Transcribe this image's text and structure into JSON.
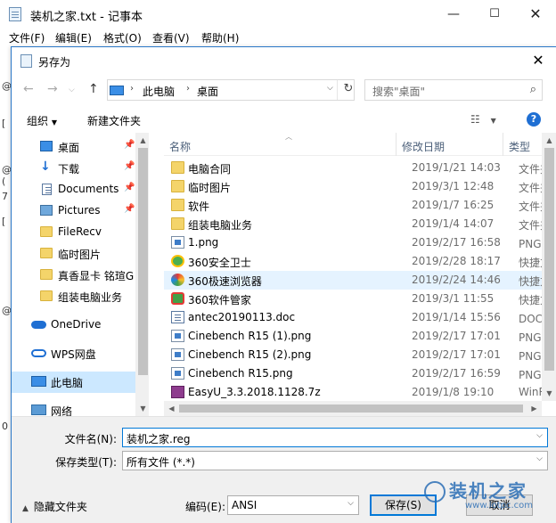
{
  "notepad": {
    "title": "装机之家.txt - 记事本",
    "menu": [
      "文件(F)",
      "编辑(E)",
      "格式(O)",
      "查看(V)",
      "帮助(H)"
    ],
    "edge_chars": [
      "@",
      "[",
      "@",
      "(",
      "7",
      "[",
      "@",
      "0"
    ]
  },
  "dialog": {
    "title": "另存为",
    "address": {
      "root": "此电脑",
      "current": "桌面"
    },
    "search_placeholder": "搜索\"桌面\"",
    "toolbar": {
      "organize": "组织",
      "new_folder": "新建文件夹"
    }
  },
  "nav": {
    "items": [
      {
        "label": "桌面",
        "icon": "desktop-icon",
        "pinned": true
      },
      {
        "label": "下载",
        "icon": "download-icon",
        "pinned": true
      },
      {
        "label": "Documents",
        "icon": "documents-icon",
        "pinned": true
      },
      {
        "label": "Pictures",
        "icon": "pictures-icon",
        "pinned": true
      },
      {
        "label": "FileRecv",
        "icon": "folder-icon",
        "pinned": false
      },
      {
        "label": "临时图片",
        "icon": "folder-icon",
        "pinned": false
      },
      {
        "label": "真香显卡 铭瑄G",
        "icon": "folder-icon",
        "pinned": false
      },
      {
        "label": "组装电脑业务",
        "icon": "folder-icon",
        "pinned": false
      },
      {
        "label": "OneDrive",
        "icon": "onedrive-icon",
        "pinned": false
      },
      {
        "label": "WPS网盘",
        "icon": "cloud-icon",
        "pinned": false
      },
      {
        "label": "此电脑",
        "icon": "pc-icon",
        "pinned": false,
        "selected": true
      },
      {
        "label": "网络",
        "icon": "network-icon",
        "pinned": false
      }
    ]
  },
  "files": {
    "columns": {
      "name": "名称",
      "date": "修改日期",
      "type": "类型"
    },
    "rows": [
      {
        "name": "电脑合同",
        "date": "2019/1/21 14:03",
        "type": "文件夹",
        "icon": "folder-icon"
      },
      {
        "name": "临时图片",
        "date": "2019/3/1 12:48",
        "type": "文件夹",
        "icon": "folder-icon"
      },
      {
        "name": "软件",
        "date": "2019/1/7 16:25",
        "type": "文件夹",
        "icon": "folder-icon"
      },
      {
        "name": "组装电脑业务",
        "date": "2019/1/4 14:07",
        "type": "文件夹",
        "icon": "folder-icon"
      },
      {
        "name": "1.png",
        "date": "2019/2/17 16:58",
        "type": "PNG 文",
        "icon": "png-icon"
      },
      {
        "name": "360安全卫士",
        "date": "2019/2/28 18:17",
        "type": "快捷方",
        "icon": "360-safe-icon"
      },
      {
        "name": "360极速浏览器",
        "date": "2019/2/24 14:46",
        "type": "快捷方",
        "icon": "360-browser-icon",
        "hover": true
      },
      {
        "name": "360软件管家",
        "date": "2019/3/1 11:55",
        "type": "快捷方",
        "icon": "360-manager-icon"
      },
      {
        "name": "antec20190113.doc",
        "date": "2019/1/14 15:56",
        "type": "DOC 文",
        "icon": "doc-icon"
      },
      {
        "name": "Cinebench R15 (1).png",
        "date": "2019/2/17 17:01",
        "type": "PNG 文",
        "icon": "png-icon"
      },
      {
        "name": "Cinebench R15 (2).png",
        "date": "2019/2/17 17:01",
        "type": "PNG 文",
        "icon": "png-icon"
      },
      {
        "name": "Cinebench R15.png",
        "date": "2019/2/17 16:59",
        "type": "PNG 文",
        "icon": "png-icon"
      },
      {
        "name": "EasyU_3.3.2018.1128.7z",
        "date": "2019/1/8 19:10",
        "type": "WinRA",
        "icon": "archive-icon"
      }
    ]
  },
  "bottom": {
    "filename_label": "文件名(N):",
    "filename_value": "装机之家.reg",
    "filetype_label": "保存类型(T):",
    "filetype_value": "所有文件 (*.*)",
    "hide_folders": "隐藏文件夹",
    "encoding_label": "编码(E):",
    "encoding_value": "ANSI",
    "save": "保存(S)",
    "cancel": "取消"
  },
  "watermark": {
    "text": "装机之家",
    "url": "www.lotpc.com"
  }
}
